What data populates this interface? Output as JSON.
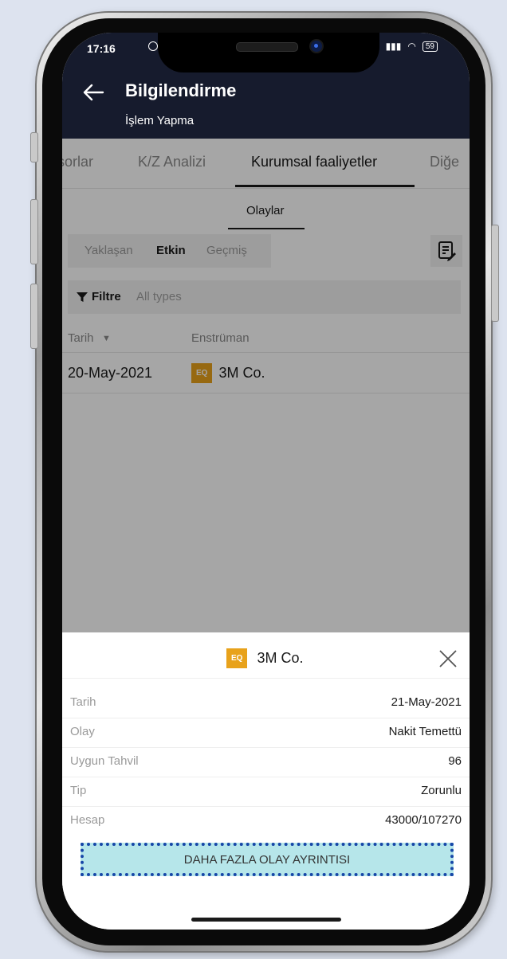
{
  "status": {
    "time": "17:16",
    "battery": "59"
  },
  "header": {
    "title": "Bilgilendirme",
    "subtitle": "İşlem Yapma"
  },
  "tabs": [
    {
      "label": "sorlar"
    },
    {
      "label": "K/Z Analizi"
    },
    {
      "label": "Kurumsal faaliyetler"
    },
    {
      "label": "Diğe"
    }
  ],
  "subtab": "Olaylar",
  "segments": {
    "upcoming": "Yaklaşan",
    "active": "Etkin",
    "past": "Geçmiş"
  },
  "filter": {
    "label": "Filtre",
    "value": "All types"
  },
  "table": {
    "columns": [
      "Tarih",
      "Enstrüman"
    ],
    "rows": [
      {
        "date": "20-May-2021",
        "badge": "EQ",
        "instrument": "3M Co."
      }
    ]
  },
  "sheet": {
    "badge": "EQ",
    "title": "3M Co.",
    "rows": [
      {
        "label": "Tarih",
        "value": "21-May-2021"
      },
      {
        "label": "Olay",
        "value": "Nakit Temettü"
      },
      {
        "label": "Uygun Tahvil",
        "value": "96"
      },
      {
        "label": "Tip",
        "value": "Zorunlu"
      },
      {
        "label": "Hesap",
        "value": "43000/107270"
      }
    ],
    "button": "DAHA FAZLA OLAY AYRINTISI"
  },
  "colors": {
    "header_bg": "#161b2d",
    "badge": "#e8a21b",
    "button_bg": "#b6e6ea",
    "button_border": "#1747a8"
  }
}
